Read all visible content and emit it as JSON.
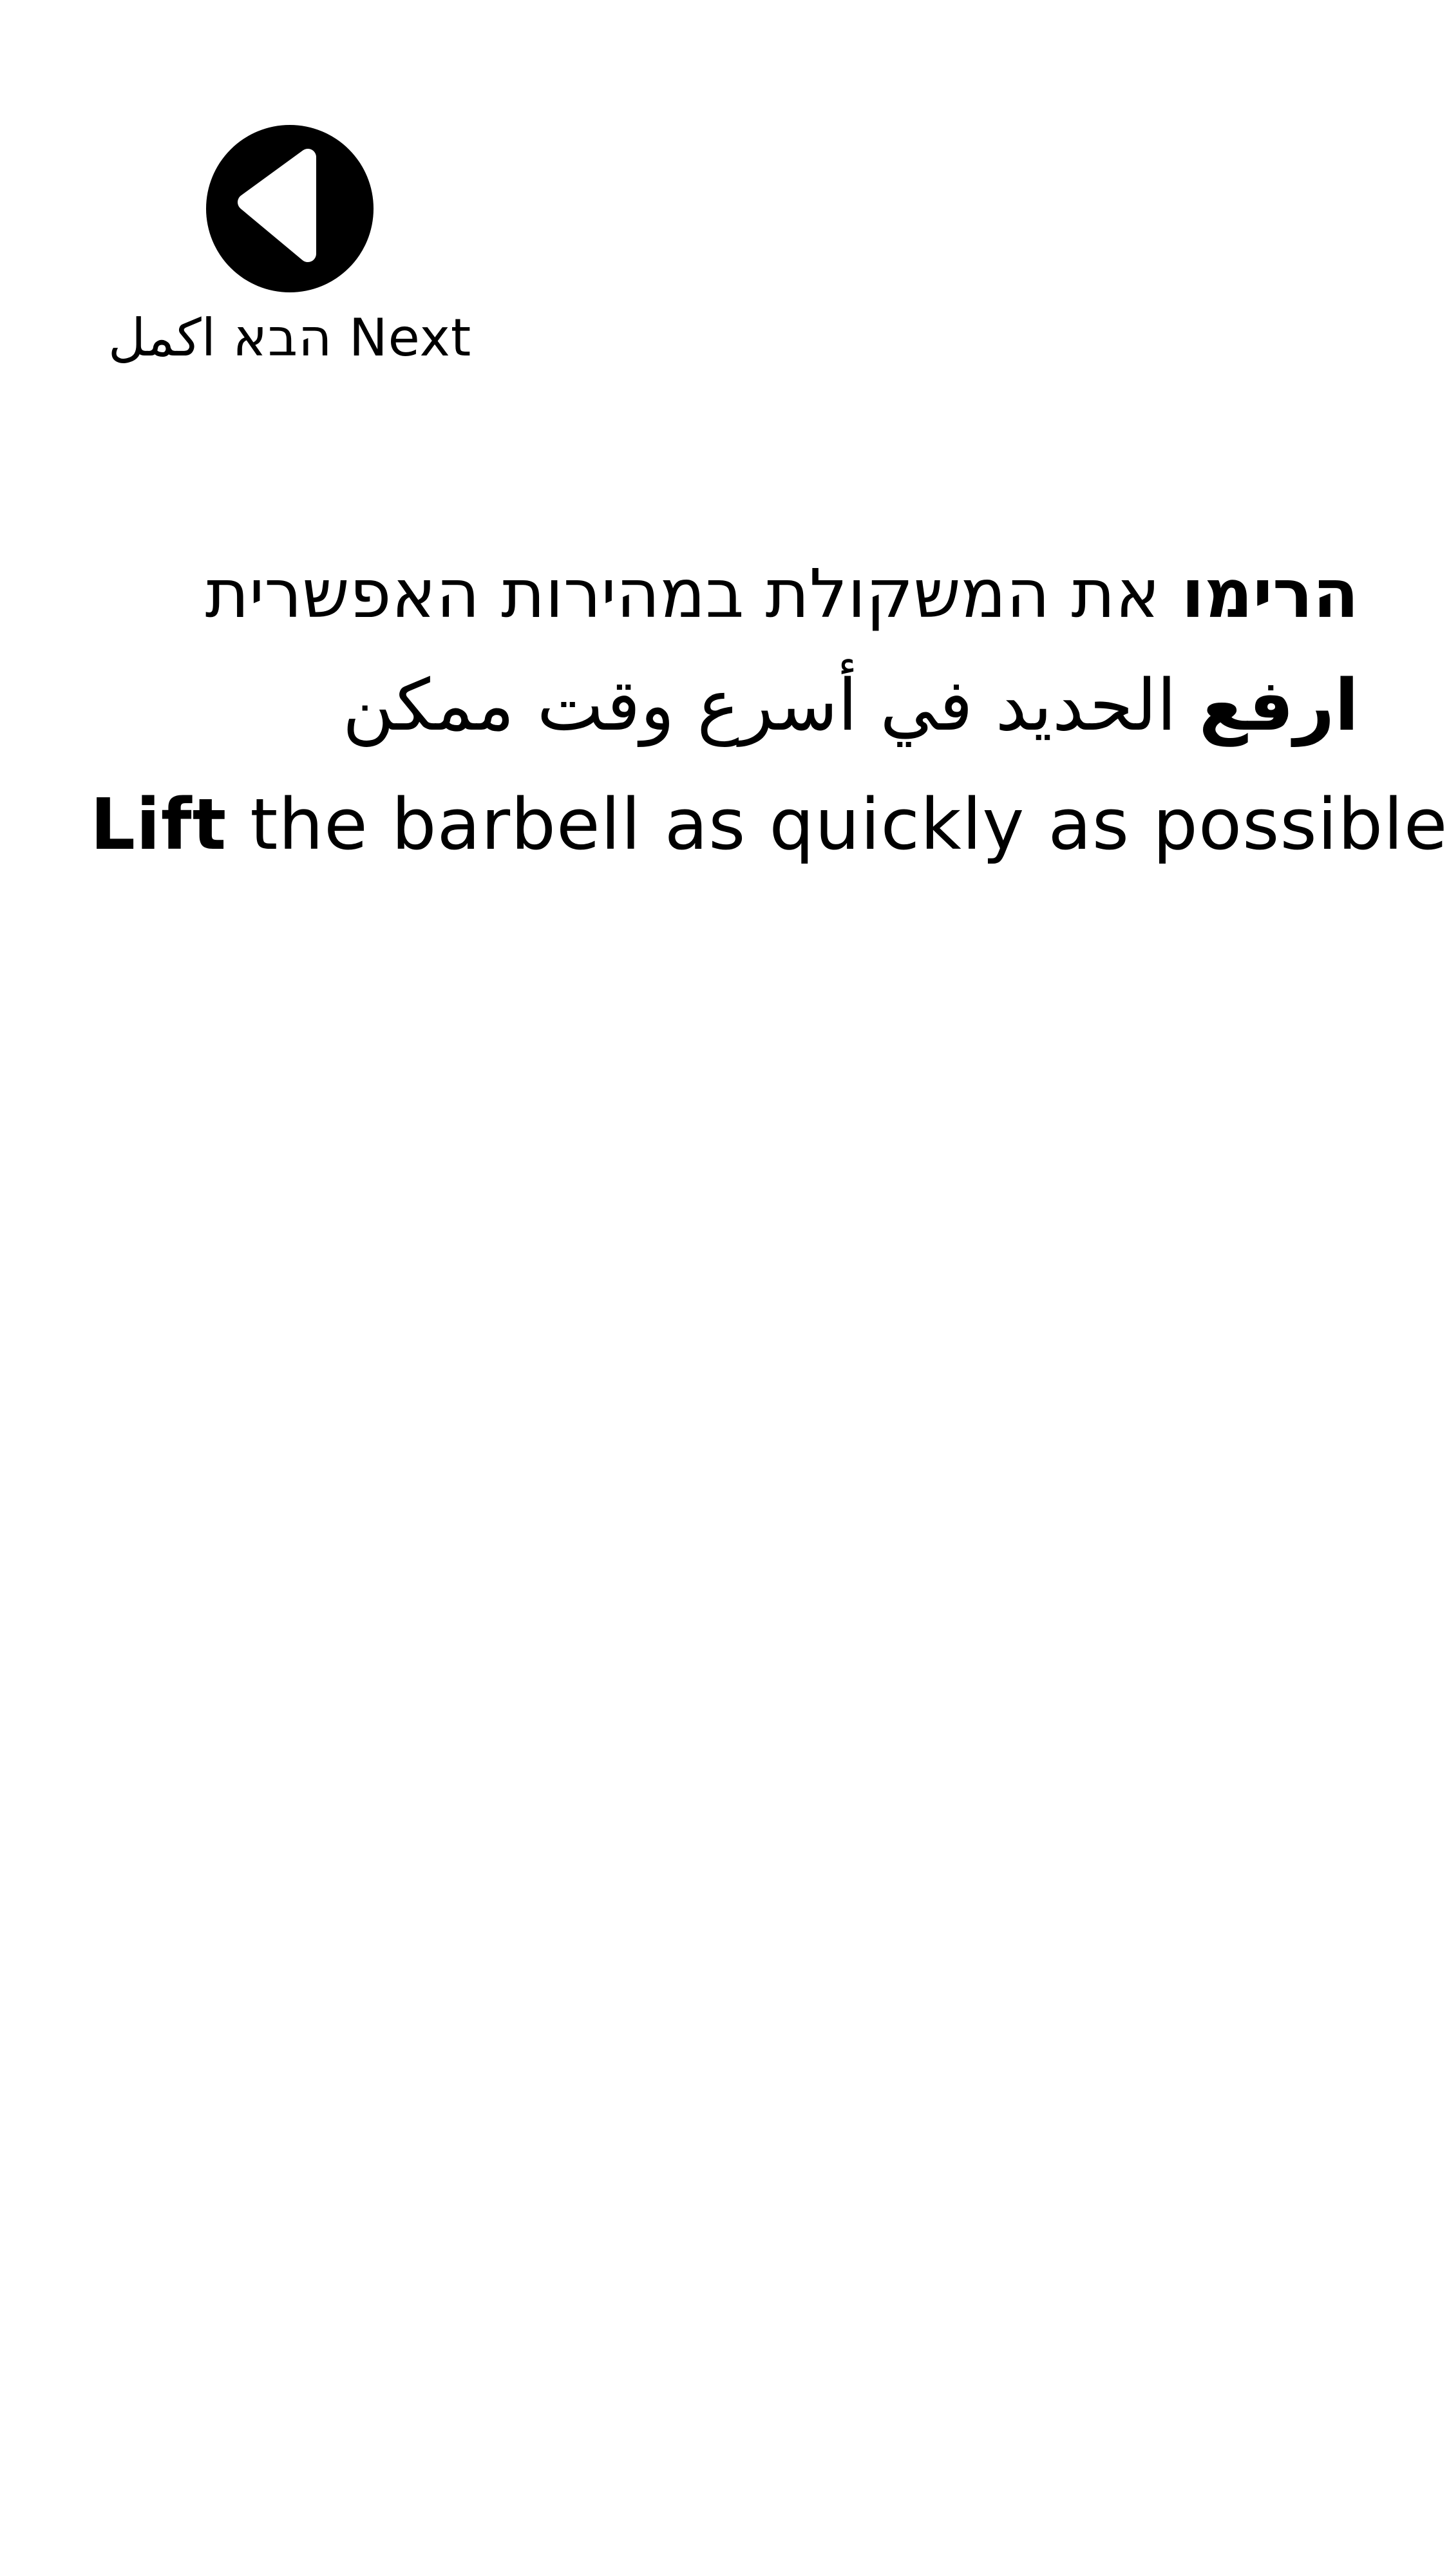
{
  "next_button": {
    "icon": "play-reverse-icon",
    "label": "הבא اكمل Next",
    "colors": {
      "circle": "#000000",
      "arrow": "#ffffff"
    }
  },
  "instruction": {
    "hebrew": {
      "bold": "הרימו",
      "rest": " את המשקולת במהירות האפשרית"
    },
    "arabic": {
      "bold": "ارفع",
      "rest": " الحديد في أسرع وقت ممكن"
    },
    "english": {
      "bold": "Lift",
      "rest": " the barbell as quickly as possible"
    }
  }
}
